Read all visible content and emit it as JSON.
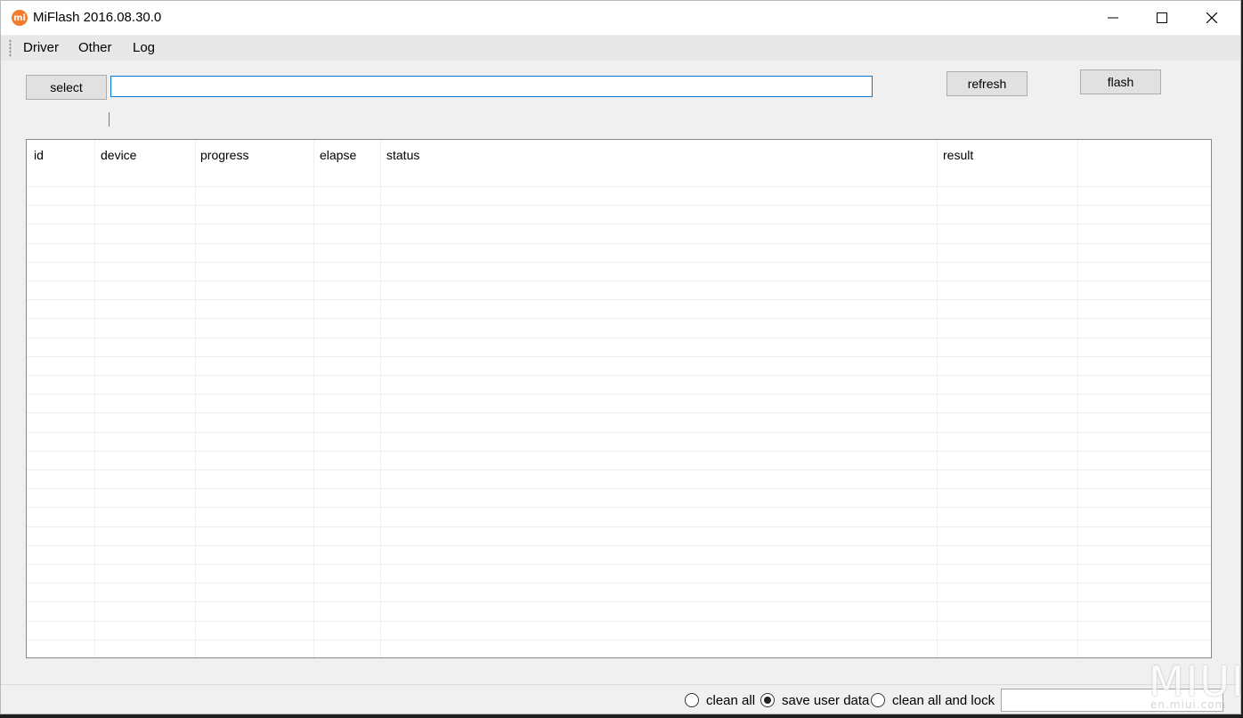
{
  "window": {
    "title": "MiFlash 2016.08.30.0",
    "icon_text": "mi"
  },
  "menu": {
    "items": [
      "Driver",
      "Other",
      "Log"
    ]
  },
  "toolbar": {
    "select_label": "select",
    "path_value": "",
    "refresh_label": "refresh",
    "flash_label": "flash"
  },
  "grid": {
    "columns": [
      "id",
      "device",
      "progress",
      "elapse",
      "status",
      "result"
    ],
    "rows": []
  },
  "options": {
    "items": [
      {
        "label": "clean all",
        "selected": false
      },
      {
        "label": "save user data",
        "selected": true
      },
      {
        "label": "clean all and lock",
        "selected": false
      }
    ],
    "status_value": ""
  },
  "watermark": {
    "logo": "MIUI",
    "site": "en.miui.com"
  }
}
